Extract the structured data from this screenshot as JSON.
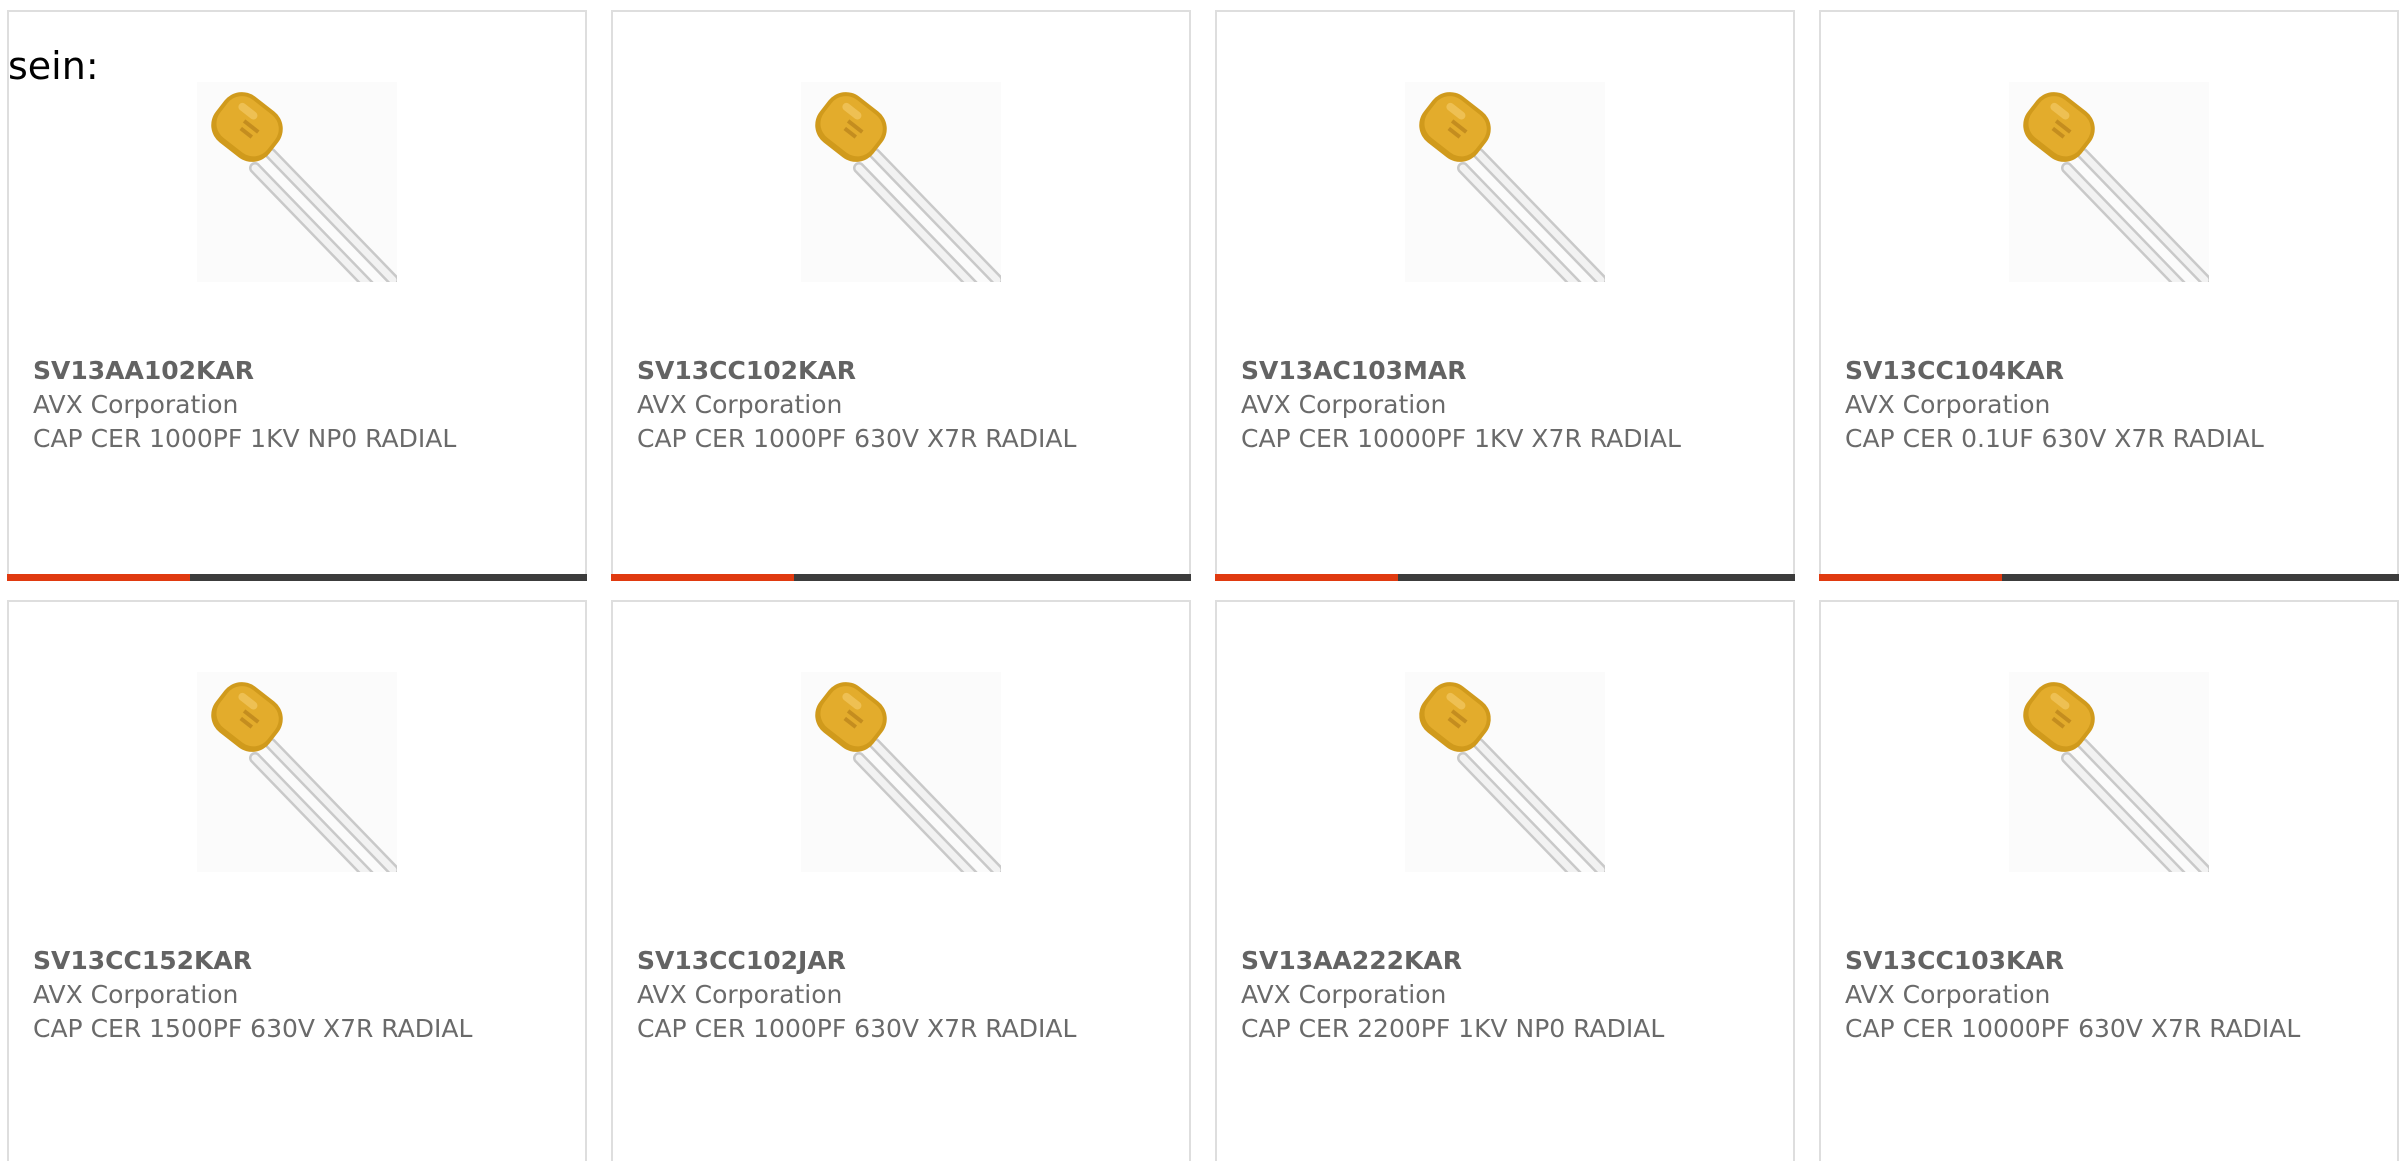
{
  "intro_text": "sein:",
  "accent_color": "#e03a10",
  "bar_color": "#3c3c3c",
  "image_icon": "ceramic-capacitor-icon",
  "products": [
    {
      "part": "SV13AA102KAR",
      "manufacturer": "AVX Corporation",
      "description": "CAP CER 1000PF 1KV NP0 RADIAL"
    },
    {
      "part": "SV13CC102KAR",
      "manufacturer": "AVX Corporation",
      "description": "CAP CER 1000PF 630V X7R RADIAL"
    },
    {
      "part": "SV13AC103MAR",
      "manufacturer": "AVX Corporation",
      "description": "CAP CER 10000PF 1KV X7R RADIAL"
    },
    {
      "part": "SV13CC104KAR",
      "manufacturer": "AVX Corporation",
      "description": "CAP CER 0.1UF 630V X7R RADIAL"
    },
    {
      "part": "SV13CC152KAR",
      "manufacturer": "AVX Corporation",
      "description": "CAP CER 1500PF 630V X7R RADIAL"
    },
    {
      "part": "SV13CC102JAR",
      "manufacturer": "AVX Corporation",
      "description": "CAP CER 1000PF 630V X7R RADIAL"
    },
    {
      "part": "SV13AA222KAR",
      "manufacturer": "AVX Corporation",
      "description": "CAP CER 2200PF 1KV NP0 RADIAL"
    },
    {
      "part": "SV13CC103KAR",
      "manufacturer": "AVX Corporation",
      "description": "CAP CER 10000PF 630V X7R RADIAL"
    }
  ]
}
